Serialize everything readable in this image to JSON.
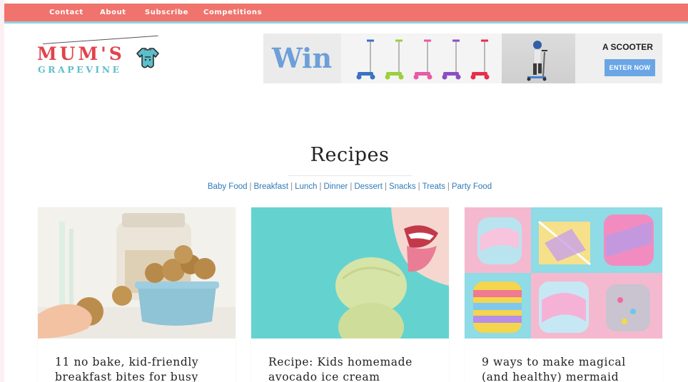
{
  "nav": {
    "items": [
      "Contact",
      "About",
      "Subscribe",
      "Competitions"
    ]
  },
  "logo": {
    "main": "MUM'S",
    "sub": "GRAPEVINE"
  },
  "ad": {
    "win_text": "Win",
    "title": "A SCOOTER",
    "button": "ENTER NOW",
    "scooter_colors": [
      "#3a73c4",
      "#9ccf3a",
      "#e85aa8",
      "#8a4fc3",
      "#e5304a"
    ]
  },
  "page": {
    "title": "Recipes",
    "categories": [
      "Baby Food",
      "Breakfast",
      "Lunch",
      "Dinner",
      "Dessert",
      "Snacks",
      "Treats",
      "Party Food"
    ]
  },
  "cards": [
    {
      "title": "11 no bake, kid-friendly breakfast bites for busy"
    },
    {
      "title": "Recipe: Kids homemade avocado ice cream"
    },
    {
      "title": "9 ways to make magical (and healthy) mermaid"
    }
  ],
  "colors": {
    "nav_bg": "#f0736d",
    "nav_stripe": "#8fd3dc",
    "logo_red": "#e2434b",
    "logo_teal": "#5bbfcb",
    "link": "#2e7bb8",
    "ad_button": "#6aa6e6"
  }
}
